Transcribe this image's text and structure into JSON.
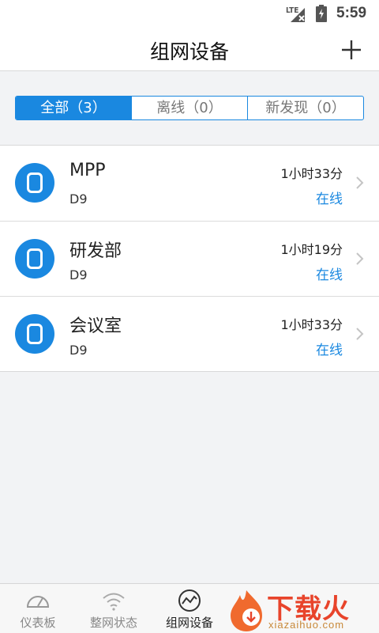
{
  "status_bar": {
    "network": "LTE",
    "time": "5:59"
  },
  "header": {
    "title": "组网设备",
    "add_icon": "plus-icon"
  },
  "filter_tabs": [
    {
      "label": "全部（3）",
      "active": true
    },
    {
      "label": "离线（0）",
      "active": false
    },
    {
      "label": "新发现（0）",
      "active": false
    }
  ],
  "devices": [
    {
      "name": "MPP",
      "model": "D9",
      "uptime": "1小时33分",
      "status": "在线"
    },
    {
      "name": "研发部",
      "model": "D9",
      "uptime": "1小时19分",
      "status": "在线"
    },
    {
      "name": "会议室",
      "model": "D9",
      "uptime": "1小时33分",
      "status": "在线"
    }
  ],
  "bottom_nav": [
    {
      "label": "仪表板",
      "icon": "gauge-icon",
      "active": false
    },
    {
      "label": "整网状态",
      "icon": "wifi-icon",
      "active": false
    },
    {
      "label": "组网设备",
      "icon": "network-chart-icon",
      "active": true
    }
  ],
  "watermark": {
    "brand": "下载火",
    "domain": "xiazaihuo.com"
  },
  "colors": {
    "accent": "#1a88e0",
    "header_bg": "#ffffff",
    "page_bg": "#f2f3f5",
    "watermark": "#e8442b"
  }
}
